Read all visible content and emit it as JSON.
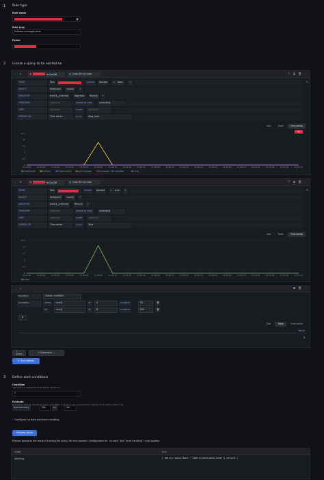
{
  "steps": {
    "s1": {
      "num": "1",
      "title": "Rule type"
    },
    "s2": {
      "num": "2",
      "title": "Create a query to be alerted on"
    },
    "s3": {
      "num": "3",
      "title": "Define alert conditions"
    }
  },
  "rule_type": {
    "rule_name_label": "Rule name",
    "rule_type_label": "Rule type",
    "rule_type_value": "Grafana managed alert",
    "folder_label": "Folder"
  },
  "queryA": {
    "ref": "A",
    "datasource": "InfluxDB",
    "time_range": "now-5m to now",
    "from_label": "FROM",
    "from_value": "Telis",
    "where_label": "WHERE",
    "where_field": "blocked",
    "where_op": "=",
    "where_val": "false",
    "select_label": "SELECT",
    "select_field": "field(user)",
    "select_fn": "count()",
    "group_by_label": "GROUP BY",
    "group_time": "time($__interval)",
    "group_tag": "tag(host)",
    "group_fill": "fill(null)",
    "timezone_label": "TIMEZONE",
    "timezone_val": "(optional)",
    "order_label": "ORDER BY TIME",
    "order_val": "ascending",
    "limit_label": "LIMIT",
    "limit_val": "(optional)",
    "slimit_label": "SLIMIT",
    "slimit_val": "(optional)",
    "format_label": "FORMAT AS",
    "format_val": "Time series",
    "alias_label": "ALIAS",
    "alias_val": "$tag_host",
    "legend": [
      "kabelmeth",
      "lostkde",
      "othername5",
      "grocerybase",
      "meowow",
      "sophiflair",
      "reen"
    ]
  },
  "queryB": {
    "ref": "B",
    "datasource": "InfluxDB",
    "time_range": "now-5m to now",
    "from_label": "FROM",
    "from_value": "Telis",
    "where_label": "WHERE",
    "where_field": "blocked",
    "where_op": "=",
    "where_val": "true",
    "select_label": "SELECT",
    "select_field": "field(user)",
    "select_fn": "count()",
    "group_by_label": "GROUP BY",
    "group_time": "time($__interval)",
    "group_fill": "fill(null)",
    "timezone_label": "TIMEZONE",
    "timezone_val": "(optional)",
    "order_label": "ORDER BY TIME",
    "order_val": "ascending",
    "limit_label": "LIMIT",
    "limit_val": "(optional)",
    "slimit_label": "SLIMIT",
    "slimit_val": "(optional)",
    "format_label": "FORMAT AS",
    "format_val": "Time series",
    "alias_label": "ALIAS",
    "alias_val": "Total",
    "legend": [
      "Total"
    ]
  },
  "view_tabs": {
    "stat": "Stat",
    "table": "Table",
    "timeseries": "Time series"
  },
  "badge_A": "50",
  "expression": {
    "ref": "C",
    "type": "Classic condition",
    "operation_label": "Operation",
    "conditions_label": "Conditions",
    "cond1": {
      "when": "WHEN",
      "fn": "sum()",
      "of": "OF",
      "ref": "A",
      "op": "IS ABOVE",
      "val": "50"
    },
    "cond2": {
      "when": "OR",
      "fn": "sum()",
      "of": "OF",
      "ref": "B",
      "op": "IS ABOVE",
      "val": "500"
    },
    "table_header": "Value",
    "table_value": "0"
  },
  "buttons": {
    "query": "+ Query",
    "expression": "+ Expression",
    "run": "Run queries",
    "preview": "Preview alerts"
  },
  "conditions": {
    "condition_label": "Condition",
    "condition_desc": "The query or expression that will be alerted on",
    "condition_value": "C",
    "evaluate_label": "Evaluate",
    "evaluate_desc": "Evaluation interval applies to every rule within a group. It can overwrite the interval of an existing alert rule.",
    "every_label": "Evaluate every",
    "every_val": "30s",
    "for_label": "for",
    "for_val": "5m",
    "no_data": "Configure no data and error handling",
    "preview_desc": "Preview based on the result of running the query, for this moment. Configuration for `no data` and `error handling` is not applied."
  },
  "result": {
    "col_state": "State",
    "col_info": "Info",
    "state": "Alerting",
    "info": "[ metric='pencilsmell' labels={host=pencilsmell} value=9 ]"
  },
  "chart_data": [
    {
      "type": "line",
      "x": [
        "11:42:45",
        "11:43:00",
        "11:43:15",
        "11:43:30",
        "11:43:45",
        "11:44:00",
        "11:44:15",
        "11:44:30",
        "11:44:45",
        "11:45:00",
        "11:45:15",
        "11:45:30",
        "11:45:45",
        "11:46:00",
        "11:46:15",
        "11:46:30",
        "11:46:45",
        "11:47:00",
        "11:47:15",
        "11:47:30"
      ],
      "yticks": [
        "12.5",
        "10",
        "7.5",
        "5",
        "2.5",
        "0"
      ],
      "ylim": [
        0,
        12.5
      ],
      "series": [
        {
          "name": "kabelmeth",
          "color": "#73bf69",
          "values": [
            0,
            0,
            0,
            0,
            0,
            0,
            0,
            0,
            0,
            0,
            0,
            0,
            0,
            0,
            0,
            0,
            0,
            0,
            0,
            0
          ]
        },
        {
          "name": "lostkde",
          "color": "#fade2a",
          "values": [
            0,
            0,
            0,
            0,
            0,
            9,
            0,
            0,
            0,
            0,
            0,
            0,
            0,
            0,
            0,
            0,
            0,
            0,
            0,
            0
          ]
        },
        {
          "name": "othername5",
          "color": "#5794f2",
          "values": [
            0,
            0,
            0,
            0,
            0,
            0,
            0,
            0,
            0,
            0,
            0,
            0,
            0,
            0,
            0,
            0,
            0,
            0,
            0,
            0
          ]
        },
        {
          "name": "grocerybase",
          "color": "#ff9830",
          "values": [
            0,
            0,
            0,
            0,
            0,
            0,
            0,
            0,
            0,
            0,
            0,
            0,
            0,
            0,
            0,
            0,
            0,
            0,
            0,
            0
          ]
        },
        {
          "name": "meowow",
          "color": "#f2495c",
          "values": [
            0,
            0,
            0,
            0,
            0,
            0,
            0,
            0,
            0,
            0,
            0,
            0,
            0,
            0,
            0,
            0,
            0,
            0,
            0,
            0
          ]
        },
        {
          "name": "sophiflair",
          "color": "#5794f2",
          "values": [
            0,
            0,
            0,
            0,
            0,
            0,
            0,
            0,
            0,
            0,
            0,
            0,
            0,
            0,
            0,
            0,
            0,
            0,
            0,
            0
          ]
        },
        {
          "name": "reen",
          "color": "#b877d9",
          "values": [
            0,
            0,
            0,
            0,
            0,
            0,
            0,
            0,
            0,
            0,
            0,
            0,
            0,
            0,
            0,
            0,
            0,
            0,
            0,
            0
          ]
        }
      ]
    },
    {
      "type": "line",
      "x": [
        "11:42:45",
        "11:43:00",
        "11:43:15",
        "11:43:30",
        "11:43:45",
        "11:44:00",
        "11:44:15",
        "11:44:30",
        "11:44:45",
        "11:45:00",
        "11:45:15",
        "11:45:30",
        "11:45:45",
        "11:46:00",
        "11:46:15",
        "11:46:30",
        "11:46:45",
        "11:47:00",
        "11:47:15",
        "11:47:30"
      ],
      "yticks": [
        "12.5",
        "10",
        "7.5",
        "5",
        "2.5",
        "0"
      ],
      "ylim": [
        0,
        12.5
      ],
      "series": [
        {
          "name": "Total",
          "color": "#73bf69",
          "values": [
            0,
            0,
            0,
            0,
            0,
            10.5,
            0,
            0,
            0,
            0,
            0,
            0,
            0,
            0,
            0,
            0,
            0,
            0,
            0,
            0
          ]
        }
      ]
    }
  ]
}
